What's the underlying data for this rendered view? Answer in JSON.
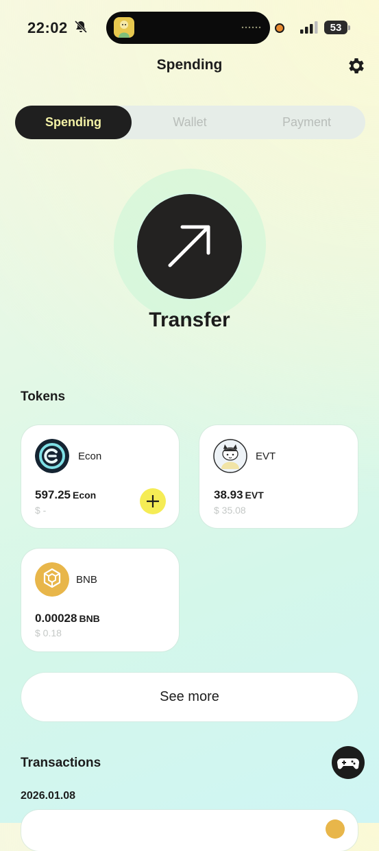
{
  "status_bar": {
    "time": "22:02",
    "battery": "53",
    "icons": [
      "bell-slash-icon",
      "signal-icon",
      "battery-icon"
    ]
  },
  "header": {
    "title": "Spending",
    "settings_icon": "gear-icon"
  },
  "tabs": [
    {
      "label": "Spending",
      "active": true
    },
    {
      "label": "Wallet",
      "active": false
    },
    {
      "label": "Payment",
      "active": false
    }
  ],
  "transfer": {
    "label": "Transfer",
    "icon": "arrow-up-right-icon"
  },
  "tokens": {
    "title": "Tokens",
    "items": [
      {
        "name": "Econ",
        "amount": "597.25",
        "unit": "Econ",
        "fiat": "$ -",
        "icon": "econ-token-icon",
        "has_add": true
      },
      {
        "name": "EVT",
        "amount": "38.93",
        "unit": "EVT",
        "fiat": "$ 35.08",
        "icon": "evt-token-icon",
        "has_add": false
      },
      {
        "name": "BNB",
        "amount": "0.00028",
        "unit": "BNB",
        "fiat": "$ 0.18",
        "icon": "bnb-token-icon",
        "has_add": false
      }
    ],
    "see_more": "See more"
  },
  "transactions": {
    "title": "Transactions",
    "date": "2026.01.08",
    "game_icon": "gamepad-icon"
  },
  "colors": {
    "accent_yellow": "#f5ec55",
    "tab_active_text": "#f3f1a6",
    "dark": "#1f1f1f",
    "bnb": "#e8b64a"
  }
}
